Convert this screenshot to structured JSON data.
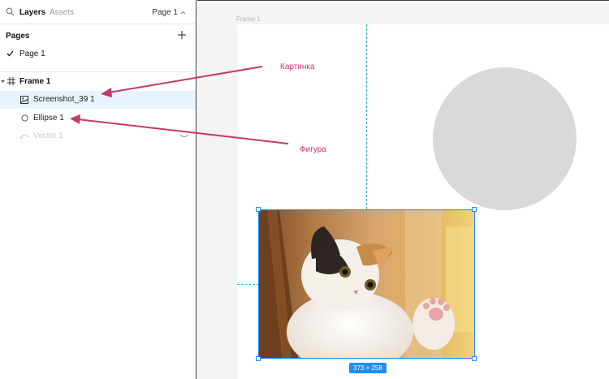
{
  "panel": {
    "tabs": {
      "layers": "Layers",
      "assets": "Assets"
    },
    "page_selector": "Page 1",
    "pages_title": "Pages",
    "pages": [
      "Page 1"
    ],
    "layers": {
      "frame": "Frame 1",
      "screenshot": "Screenshot_39 1",
      "ellipse": "Ellipse 1",
      "vector": "Vector 1"
    }
  },
  "canvas": {
    "frame_label": "Frame 1",
    "selection_size": "373 × 258"
  },
  "annotations": {
    "picture": "Картинка",
    "shape": "Фигура"
  },
  "colors": {
    "accent": "#1f8ef1",
    "annotation": "#c4396b",
    "ellipse_fill": "#d9d9d9",
    "selected_layer_bg": "#e8f3fd"
  }
}
